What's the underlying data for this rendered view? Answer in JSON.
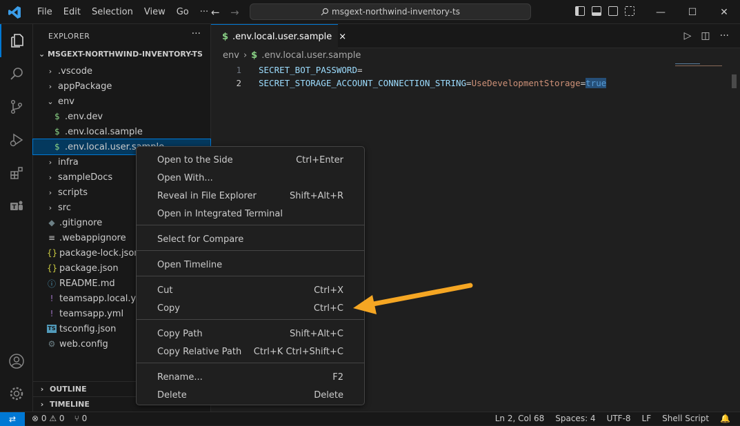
{
  "titlebar": {
    "menu": [
      "File",
      "Edit",
      "Selection",
      "View",
      "Go",
      "···"
    ],
    "search": "msgext-northwind-inventory-ts",
    "window_controls": [
      "minimize-icon",
      "maximize-icon",
      "close-icon"
    ]
  },
  "activity_bar": [
    "explorer-icon",
    "search-icon",
    "source-control-icon",
    "run-debug-icon",
    "extensions-icon",
    "teams-icon",
    "account-icon",
    "settings-gear-icon"
  ],
  "sidebar": {
    "header": "EXPLORER",
    "more": "···",
    "root": "MSGEXT-NORTHWIND-INVENTORY-TS",
    "items": [
      {
        "label": ".vscode",
        "type": "folder",
        "chev": "›",
        "icon": "",
        "color": "#cccccc"
      },
      {
        "label": "appPackage",
        "type": "folder",
        "chev": "›",
        "icon": "",
        "color": "#cccccc"
      },
      {
        "label": "env",
        "type": "folder-open",
        "chev": "⌄",
        "icon": "",
        "color": "#cccccc"
      },
      {
        "label": ".env.dev",
        "type": "file",
        "chev": "",
        "icon": "$",
        "color": "#89d185"
      },
      {
        "label": ".env.local.sample",
        "type": "file",
        "chev": "",
        "icon": "$",
        "color": "#89d185"
      },
      {
        "label": ".env.local.user.sample",
        "type": "file",
        "chev": "",
        "icon": "$",
        "color": "#89d185"
      },
      {
        "label": "infra",
        "type": "folder",
        "chev": "›",
        "icon": "",
        "color": "#cccccc"
      },
      {
        "label": "sampleDocs",
        "type": "folder",
        "chev": "›",
        "icon": "",
        "color": "#cccccc"
      },
      {
        "label": "scripts",
        "type": "folder",
        "chev": "›",
        "icon": "",
        "color": "#cccccc"
      },
      {
        "label": "src",
        "type": "folder",
        "chev": "›",
        "icon": "",
        "color": "#cccccc"
      },
      {
        "label": ".gitignore",
        "type": "file",
        "chev": "",
        "icon": "◆",
        "color": "#6d8086"
      },
      {
        "label": ".webappignore",
        "type": "file",
        "chev": "",
        "icon": "≡",
        "color": "#cccccc"
      },
      {
        "label": "package-lock.json",
        "type": "file",
        "chev": "",
        "icon": "{}",
        "color": "#cbcb41"
      },
      {
        "label": "package.json",
        "type": "file",
        "chev": "",
        "icon": "{}",
        "color": "#cbcb41"
      },
      {
        "label": "README.md",
        "type": "file",
        "chev": "",
        "icon": "ⓘ",
        "color": "#519aba"
      },
      {
        "label": "teamsapp.local.yml",
        "type": "file",
        "chev": "",
        "icon": "!",
        "color": "#a074c4"
      },
      {
        "label": "teamsapp.yml",
        "type": "file",
        "chev": "",
        "icon": "!",
        "color": "#a074c4"
      },
      {
        "label": "tsconfig.json",
        "type": "file",
        "chev": "",
        "icon": "TS",
        "color": "#519aba"
      },
      {
        "label": "web.config",
        "type": "file",
        "chev": "",
        "icon": "⚙",
        "color": "#6d8086"
      }
    ],
    "sections": [
      "OUTLINE",
      "TIMELINE"
    ]
  },
  "tab": {
    "label": ".env.local.user.sample",
    "icon": "$",
    "close": "×"
  },
  "breadcrumb": {
    "folder": "env",
    "sep": "›",
    "file": ".env.local.user.sample"
  },
  "editor": {
    "lines": [
      {
        "num": "1",
        "key": "SECRET_BOT_PASSWORD",
        "eq": "=",
        "value": "",
        "eq2": "",
        "bool": ""
      },
      {
        "num": "2",
        "key": "SECRET_STORAGE_ACCOUNT_CONNECTION_STRING",
        "eq": "=",
        "value": "UseDevelopmentStorage",
        "eq2": "=",
        "bool": "true"
      }
    ]
  },
  "context_menu": {
    "groups": [
      [
        {
          "label": "Open to the Side",
          "shortcut": "Ctrl+Enter"
        },
        {
          "label": "Open With...",
          "shortcut": ""
        },
        {
          "label": "Reveal in File Explorer",
          "shortcut": "Shift+Alt+R"
        },
        {
          "label": "Open in Integrated Terminal",
          "shortcut": ""
        }
      ],
      [
        {
          "label": "Select for Compare",
          "shortcut": ""
        }
      ],
      [
        {
          "label": "Open Timeline",
          "shortcut": ""
        }
      ],
      [
        {
          "label": "Cut",
          "shortcut": "Ctrl+X"
        },
        {
          "label": "Copy",
          "shortcut": "Ctrl+C"
        }
      ],
      [
        {
          "label": "Copy Path",
          "shortcut": "Shift+Alt+C"
        },
        {
          "label": "Copy Relative Path",
          "shortcut": "Ctrl+K Ctrl+Shift+C"
        }
      ],
      [
        {
          "label": "Rename...",
          "shortcut": "F2"
        },
        {
          "label": "Delete",
          "shortcut": "Delete"
        }
      ]
    ]
  },
  "statusbar": {
    "remote": "⇄",
    "errors": "⊗ 0",
    "warnings": "⚠ 0",
    "ports": "⑂ 0",
    "position": "Ln 2, Col 68",
    "spaces": "Spaces: 4",
    "encoding": "UTF-8",
    "eol": "LF",
    "language": "Shell Script",
    "bell": "🔔"
  },
  "colors": {
    "accent": "#0078d4",
    "annotation_arrow": "#f5a623"
  }
}
